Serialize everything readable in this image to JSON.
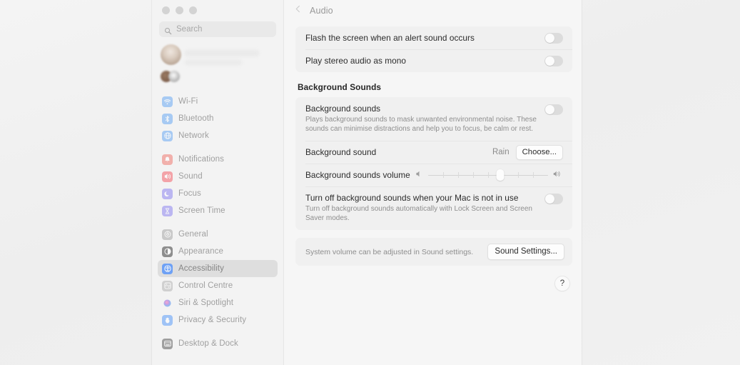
{
  "window": {
    "traffic_lights": [
      "close",
      "minimize",
      "zoom"
    ]
  },
  "sidebar": {
    "search": {
      "placeholder": "Search",
      "value": "",
      "icon": "search-icon"
    },
    "groups": [
      {
        "items": [
          {
            "label": "Wi-Fi",
            "icon": "wifi-icon",
            "color": "#6aa9f4",
            "selected": false
          },
          {
            "label": "Bluetooth",
            "icon": "bluetooth-icon",
            "color": "#6aa9f4",
            "selected": false
          },
          {
            "label": "Network",
            "icon": "network-globe-icon",
            "color": "#6aa9f4",
            "selected": false
          }
        ]
      },
      {
        "items": [
          {
            "label": "Notifications",
            "icon": "bell-icon",
            "color": "#f07a72",
            "selected": false
          },
          {
            "label": "Sound",
            "icon": "speaker-icon",
            "color": "#f4636b",
            "selected": false
          },
          {
            "label": "Focus",
            "icon": "moon-icon",
            "color": "#8e86f0",
            "selected": false
          },
          {
            "label": "Screen Time",
            "icon": "hourglass-icon",
            "color": "#8e86f0",
            "selected": false
          }
        ]
      },
      {
        "items": [
          {
            "label": "General",
            "icon": "gear-icon",
            "color": "#a7a7a7",
            "selected": false
          },
          {
            "label": "Appearance",
            "icon": "appearance-contrast-icon",
            "color": "#3c3c3c",
            "selected": false
          },
          {
            "label": "Accessibility",
            "icon": "accessibility-icon",
            "color": "#3b82f6",
            "selected": true
          },
          {
            "label": "Control Centre",
            "icon": "control-centre-icon",
            "color": "#b5b5b5",
            "selected": false
          },
          {
            "label": "Siri & Spotlight",
            "icon": "siri-icon",
            "color": "#8d5fd3",
            "selected": false
          },
          {
            "label": "Privacy & Security",
            "icon": "privacy-hand-icon",
            "color": "#5b9df9",
            "selected": false
          }
        ]
      },
      {
        "items": [
          {
            "label": "Desktop & Dock",
            "icon": "desktop-dock-icon",
            "color": "#5c5c5c",
            "selected": false
          }
        ]
      }
    ]
  },
  "detail": {
    "back_icon": "chevron-left-icon",
    "title": "Audio",
    "top_card": {
      "rows": [
        {
          "title": "Flash the screen when an alert sound occurs",
          "toggle": "off"
        },
        {
          "title": "Play stereo audio as mono",
          "toggle": "off"
        }
      ]
    },
    "section_title": "Background Sounds",
    "background_card": {
      "background_sounds": {
        "title": "Background sounds",
        "subtitle": "Plays background sounds to mask unwanted environmental noise. These sounds can minimise distractions and help you to focus, be calm or rest.",
        "toggle": "off"
      },
      "background_sound": {
        "title": "Background sound",
        "value": "Rain",
        "button": "Choose..."
      },
      "volume": {
        "title": "Background sounds volume",
        "min_icon": "speaker-low-icon",
        "max_icon": "speaker-high-icon",
        "value_percent": 60,
        "ticks": 7
      },
      "turn_off": {
        "title": "Turn off background sounds when your Mac is not in use",
        "subtitle": "Turn off background sounds automatically with Lock Screen and Screen Saver modes.",
        "toggle": "off"
      }
    },
    "footer": {
      "note": "System volume can be adjusted in Sound settings.",
      "button": "Sound Settings..."
    },
    "help_button": "?"
  }
}
